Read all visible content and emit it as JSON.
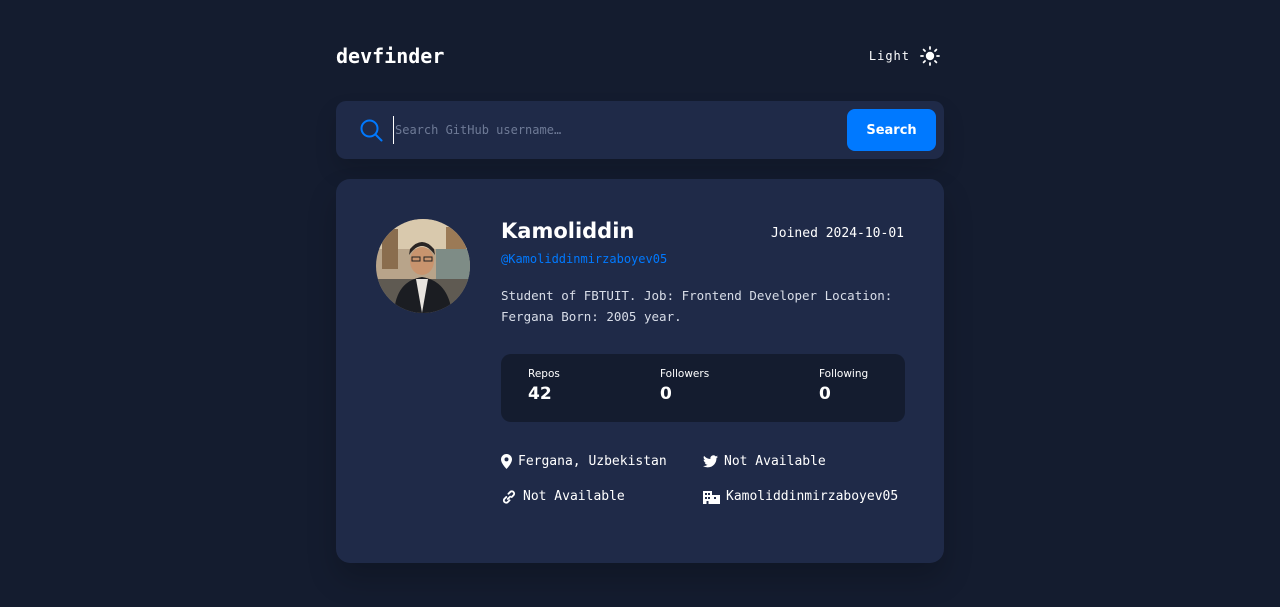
{
  "app": {
    "logo": "devfinder",
    "theme_label": "Light",
    "theme_icon": "sun-icon"
  },
  "search": {
    "placeholder": "Search GitHub username…",
    "value": "",
    "button_label": "Search",
    "icon": "search-icon"
  },
  "profile": {
    "name": "Kamoliddin",
    "login": "@Kamoliddinmirzaboyev05",
    "joined": "Joined 2024-10-01",
    "bio": "Student of FBTUIT. Job: Frontend Developer Location: Fergana Born: 2005 year.",
    "avatar": "avatar-photo"
  },
  "stats": {
    "repos_label": "Repos",
    "repos_value": "42",
    "followers_label": "Followers",
    "followers_value": "0",
    "following_label": "Following",
    "following_value": "0"
  },
  "links": {
    "location": "Fergana, Uzbekistan",
    "twitter": "Not Available",
    "blog": "Not Available",
    "company": "Kamoliddinmirzaboyev05"
  },
  "colors": {
    "background": "#141c2f",
    "card": "#1f2a48",
    "accent": "#0079ff",
    "text": "#ffffff"
  }
}
